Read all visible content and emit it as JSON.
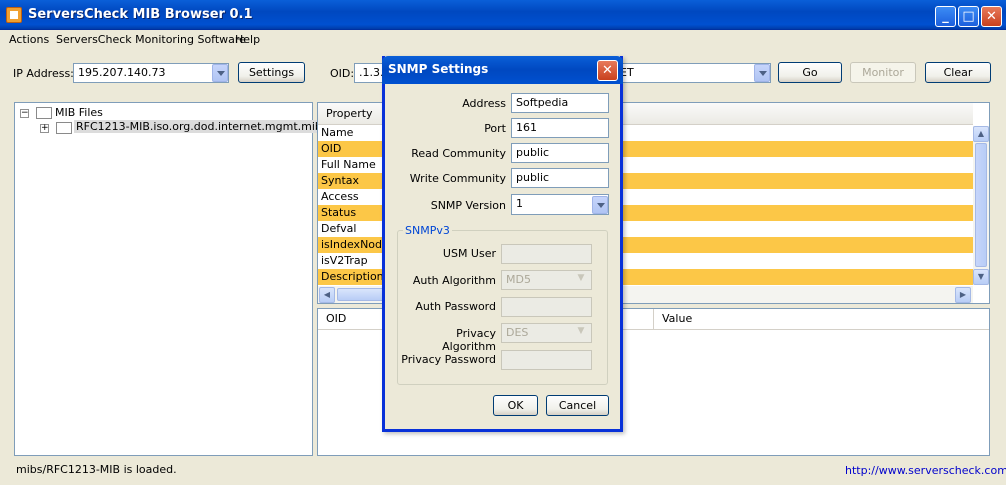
{
  "window": {
    "title": "ServersCheck MIB Browser 0.1",
    "minimize": "_",
    "maximize": "□",
    "close": "✕"
  },
  "menu": [
    "Actions",
    "ServersCheck Monitoring Software",
    "Help"
  ],
  "toolbar": {
    "ip_label": "IP Address:",
    "ip_value": "195.207.140.73",
    "settings_label": "Settings",
    "oid_label": "OID:",
    "oid_value": ".1.3.",
    "oid_value_tail": "ET",
    "go_label": "Go",
    "monitor_label": "Monitor",
    "clear_label": "Clear"
  },
  "tree": {
    "root": "MIB Files",
    "child": "RFC1213-MIB.iso.org.dod.internet.mgmt.mib-2"
  },
  "properties": {
    "header": "Property",
    "rows": [
      "Name",
      "OID",
      "Full Name",
      "Syntax",
      "Access",
      "Status",
      "Defval",
      "isIndexNode",
      "isV2Trap",
      "Description"
    ]
  },
  "results": {
    "col_oid": "OID",
    "col_value": "Value"
  },
  "status": {
    "message": "mibs/RFC1213-MIB is loaded.",
    "link": "http://www.serverscheck.com"
  },
  "dialog": {
    "title": "SNMP Settings",
    "close": "✕",
    "address_label": "Address",
    "address_value": "Softpedia",
    "port_label": "Port",
    "port_value": "161",
    "read_label": "Read Community",
    "read_value": "public",
    "write_label": "Write Community",
    "write_value": "public",
    "version_label": "SNMP Version",
    "version_value": "1",
    "v3_group": "SNMPv3",
    "usm_label": "USM User",
    "auth_alg_label": "Auth Algorithm",
    "auth_alg_value": "MD5",
    "auth_pwd_label": "Auth Password",
    "priv_alg_label": "Privacy Algorithm",
    "priv_alg_value": "DES",
    "priv_pwd_label": "Privacy Password",
    "ok_label": "OK",
    "cancel_label": "Cancel"
  },
  "colors": {
    "title_blue": "#0050d0",
    "row_highlight": "#fcc747",
    "link_blue": "#0000cc"
  }
}
